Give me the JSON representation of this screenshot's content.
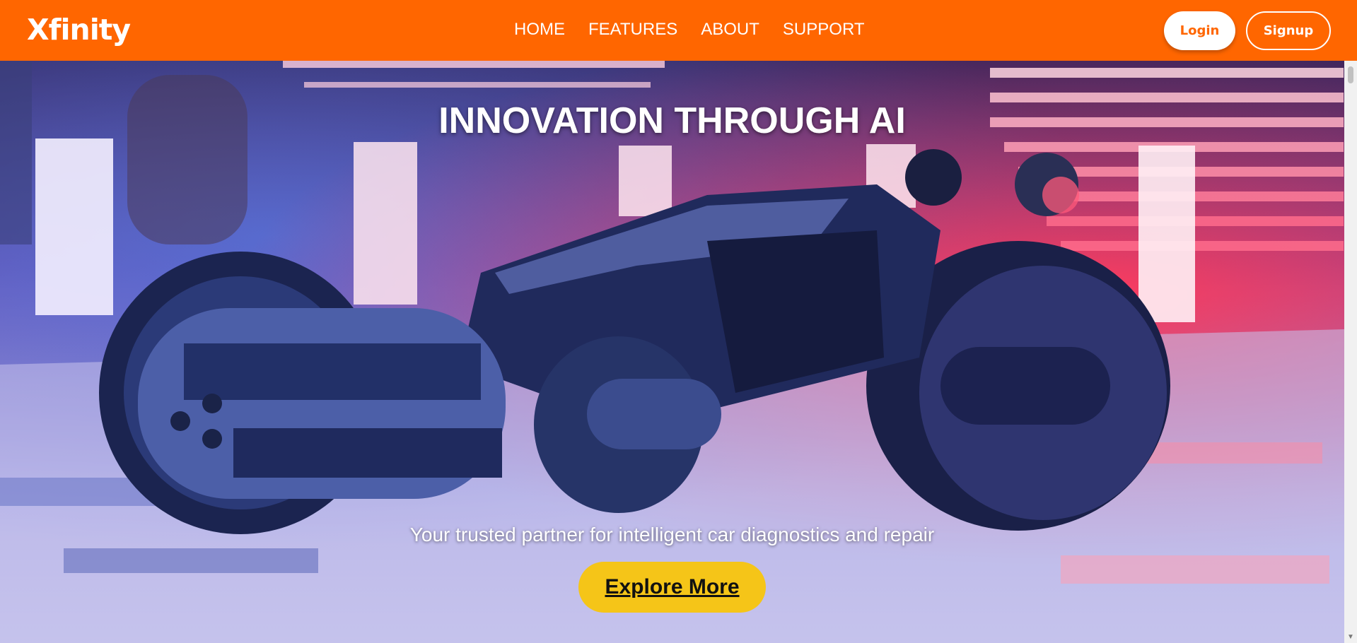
{
  "brand": {
    "logo_text": "Xfinity",
    "accent": "#ff6600",
    "cta_color": "#f5c518"
  },
  "nav": {
    "links": [
      {
        "label": "HOME"
      },
      {
        "label": "FEATURES"
      },
      {
        "label": "ABOUT"
      },
      {
        "label": "SUPPORT"
      }
    ],
    "login_label": "Login",
    "signup_label": "Signup"
  },
  "hero": {
    "title": "INNOVATION THROUGH AI",
    "subtitle": "Your trusted partner for intelligent car diagnostics and repair",
    "cta_label": "Explore More"
  }
}
